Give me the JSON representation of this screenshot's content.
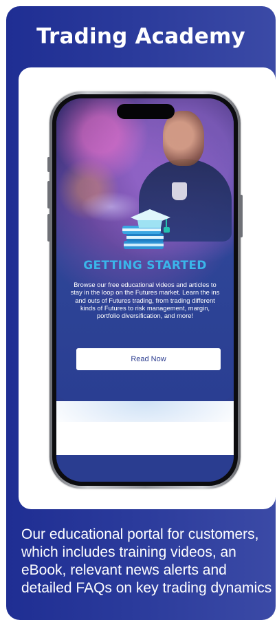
{
  "card": {
    "title": "Trading Academy",
    "description": "Our educational portal for customers, which includes training videos, an eBook, relevant news alerts and detailed FAQs on key trading dynamics"
  },
  "phone_screen": {
    "heading": "GETTING STARTED",
    "body": "Browse our free educational videos and articles to stay in the loop on the Futures market. Learn the ins and outs of Futures trading, from trading different kinds of Futures to risk management, margin, portfolio diversification, and more!",
    "button_label": "Read Now",
    "icon": "graduation-cap-books-icon"
  },
  "colors": {
    "card_background": "#2a3a9b",
    "heading_accent": "#3ab6ea",
    "button_text": "#2b3c8f",
    "white": "#ffffff"
  }
}
